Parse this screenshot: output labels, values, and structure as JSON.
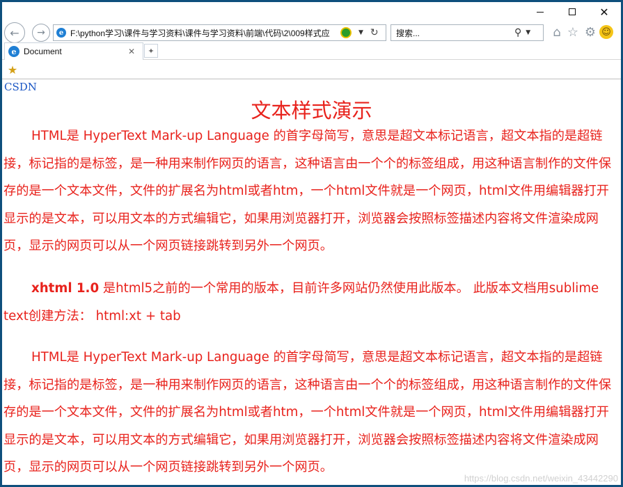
{
  "browser": {
    "address": "F:\\python学习\\课件与学习资料\\课件与学习资料\\前端\\代码\\2\\009样式应",
    "search_placeholder": "搜索...",
    "tab_label": "Document",
    "window_controls": {
      "minimize": "—",
      "maximize": "□",
      "close": "✕"
    },
    "icons": [
      "back-arrow-icon",
      "forward-arrow-icon",
      "ie-icon",
      "compat-view-icon",
      "refresh-icon",
      "search-icon",
      "home-icon",
      "favorites-star-icon",
      "settings-gear-icon",
      "feedback-smiley-icon",
      "add-favorites-icon"
    ]
  },
  "page": {
    "link": "CSDN",
    "title": "文本样式演示",
    "para1": "HTML是 HyperText Mark-up Language 的首字母简写，意思是超文本标记语言，超文本指的是超链接，标记指的是标签，是一种用来制作网页的语言，这种语言由一个个的标签组成，用这种语言制作的文件保存的是一个文本文件，文件的扩展名为html或者htm，一个html文件就是一个网页，html文件用编辑器打开显示的是文本，可以用文本的方式编辑它，如果用浏览器打开，浏览器会按照标签描述内容将文件渲染成网页，显示的网页可以从一个网页链接跳转到另外一个网页。",
    "para2_bold": "xhtml 1.0",
    "para2_rest": " 是html5之前的一个常用的版本，目前许多网站仍然使用此版本。 此版本文档用sublime text创建方法： html:xt + tab",
    "para3": "HTML是 HyperText Mark-up Language 的首字母简写，意思是超文本标记语言，超文本指的是超链接，标记指的是标签，是一种用来制作网页的语言，这种语言由一个个的标签组成，用这种语言制作的文件保存的是一个文本文件，文件的扩展名为html或者htm，一个html文件就是一个网页，html文件用编辑器打开显示的是文本，可以用文本的方式编辑它，如果用浏览器打开，浏览器会按照标签描述内容将文件渲染成网页，显示的网页可以从一个网页链接跳转到另外一个网页。",
    "watermark": "https://blog.csdn.net/weixin_43442290"
  },
  "colors": {
    "text_red": "#e8221c",
    "link_blue": "#1a56c4",
    "frame": "#0e4f7c"
  }
}
